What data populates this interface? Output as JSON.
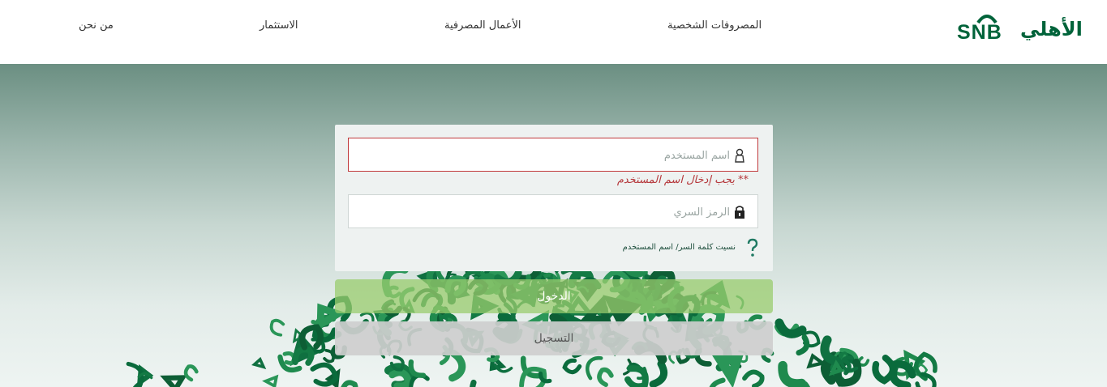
{
  "header": {
    "logo": {
      "latin": "SNB",
      "arabic": "الأهلي"
    },
    "nav": [
      {
        "label": "المصروفات الشخصية"
      },
      {
        "label": "الأعمال المصرفية"
      },
      {
        "label": "الاستثمار"
      },
      {
        "label": "من نحن"
      }
    ]
  },
  "login": {
    "username_placeholder": "اسم المستخدم",
    "username_value": "",
    "username_error": "** يجب إدخال اسم المستخدم",
    "password_placeholder": "الرمز السري",
    "password_value": "",
    "forgot_link": "نسيت كلمة السر/ اسم المستخدم",
    "login_button": "الدخول",
    "register_button": "التسجيل"
  },
  "colors": {
    "brand_green": "#00633a",
    "error_red": "#c0393b",
    "login_button": "#99cc6e",
    "register_button": "#cecece"
  }
}
